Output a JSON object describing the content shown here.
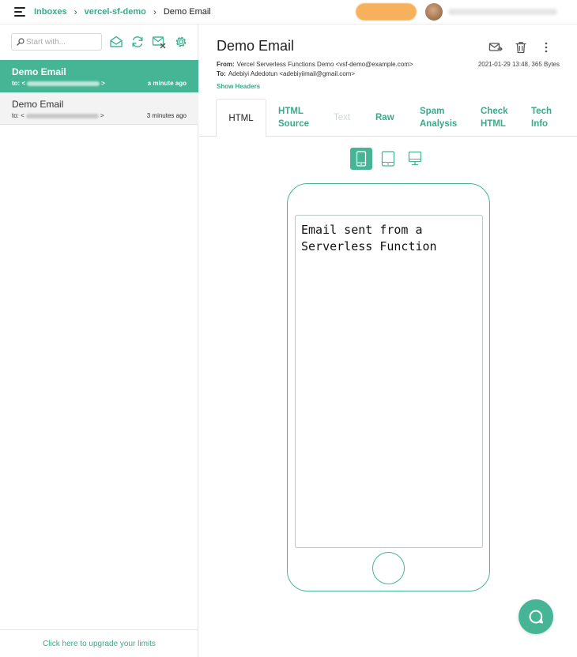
{
  "breadcrumb": {
    "inboxes": "Inboxes",
    "inbox": "vercel-sf-demo",
    "current": "Demo Email",
    "separator": "›"
  },
  "sidebar": {
    "search_placeholder": "Start with...",
    "messages": [
      {
        "subject": "Demo Email",
        "to_prefix": "to: <",
        "to_suffix": ">",
        "time": "a minute ago",
        "active": true
      },
      {
        "subject": "Demo Email",
        "to_prefix": "to: <",
        "to_suffix": ">",
        "time": "3 minutes ago",
        "active": false
      }
    ],
    "footer": "Click here to upgrade your limits"
  },
  "email": {
    "title": "Demo Email",
    "from_label": "From:",
    "from_value": "Vercel Serverless Functions Demo <vsf-demo@example.com>",
    "to_label": "To:",
    "to_value": "Adebiyi Adedotun <adebiyiimail@gmail.com>",
    "date_size": "2021-01-29 13:48, 365 Bytes",
    "show_headers": "Show Headers",
    "body_text": "Email sent from a Serverless Function"
  },
  "tabs": [
    {
      "line1": "HTML",
      "line2": "",
      "state": "active"
    },
    {
      "line1": "HTML",
      "line2": "Source",
      "state": "normal"
    },
    {
      "line1": "Text",
      "line2": "",
      "state": "disabled"
    },
    {
      "line1": "Raw",
      "line2": "",
      "state": "normal"
    },
    {
      "line1": "Spam",
      "line2": "Analysis",
      "state": "normal"
    },
    {
      "line1": "Check",
      "line2": "HTML",
      "state": "normal"
    },
    {
      "line1": "Tech",
      "line2": "Info",
      "state": "normal"
    }
  ],
  "device_view": {
    "selected": "phone"
  },
  "colors": {
    "accent": "#45b595",
    "link": "#3aa98c",
    "upgrade": "#f6b15c",
    "disabled_tab": "#c8d9d3"
  },
  "icons": {
    "menu": "hamburger-menu-icon",
    "search": "search-icon",
    "mark_read": "envelope-open-icon",
    "refresh": "refresh-icon",
    "clear_inbox": "clear-inbox-icon",
    "settings": "gear-icon",
    "forward": "forward-mail-icon",
    "delete": "trash-icon",
    "more": "more-vertical-icon",
    "help": "chat-help-icon"
  }
}
